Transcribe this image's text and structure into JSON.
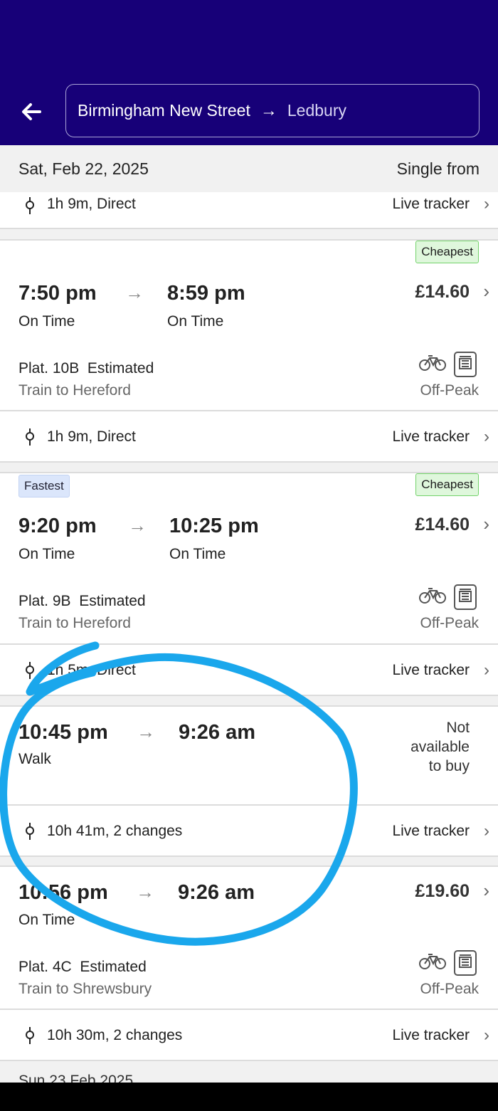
{
  "header": {
    "origin": "Birmingham New Street",
    "arrow": "→",
    "destination": "Ledbury"
  },
  "date_bar": {
    "date": "Sat, Feb 22, 2025",
    "fare_label": "Single from"
  },
  "top_partial": {
    "duration": "1h 9m, Direct",
    "live_tracker": "Live tracker"
  },
  "journeys": [
    {
      "badge_right": "Cheapest",
      "depart": "7:50 pm",
      "arrive": "8:59 pm",
      "depart_status": "On Time",
      "arrive_status": "On Time",
      "price": "£14.60",
      "platform": "Plat. 10B",
      "platform_note": "Estimated",
      "train_to": "Train to Hereford",
      "ticket_type": "Off-Peak",
      "duration": "1h 9m, Direct",
      "live_tracker": "Live tracker"
    },
    {
      "badge_left": "Fastest",
      "badge_right": "Cheapest",
      "depart": "9:20 pm",
      "arrive": "10:25 pm",
      "depart_status": "On Time",
      "arrive_status": "On Time",
      "price": "£14.60",
      "platform": "Plat. 9B",
      "platform_note": "Estimated",
      "train_to": "Train to Hereford",
      "ticket_type": "Off-Peak",
      "duration": "1h 5m, Direct",
      "live_tracker": "Live tracker"
    },
    {
      "depart": "10:45 pm",
      "arrive": "9:26 am",
      "depart_status": "Walk",
      "availability": [
        "Not",
        "available",
        "to buy"
      ],
      "duration": "10h 41m, 2 changes",
      "live_tracker": "Live tracker"
    },
    {
      "depart": "10:56 pm",
      "arrive": "9:26 am",
      "depart_status": "On Time",
      "price": "£19.60",
      "platform": "Plat. 4C",
      "platform_note": "Estimated",
      "train_to": "Train to Shrewsbury",
      "ticket_type": "Off-Peak",
      "duration": "10h 30m, 2 changes",
      "live_tracker": "Live tracker"
    }
  ],
  "next_date_partial": "Sun 23 Feb 2025",
  "icons": [
    "back-arrow-icon",
    "route-pin-icon",
    "chevron-right-icon",
    "bicycle-icon",
    "ticket-machine-icon"
  ],
  "colors": {
    "header_bg": "#170078",
    "cheapest_bg": "#dff7dc",
    "fastest_bg": "#dbe6fb",
    "annotation": "#1aa7ec"
  }
}
